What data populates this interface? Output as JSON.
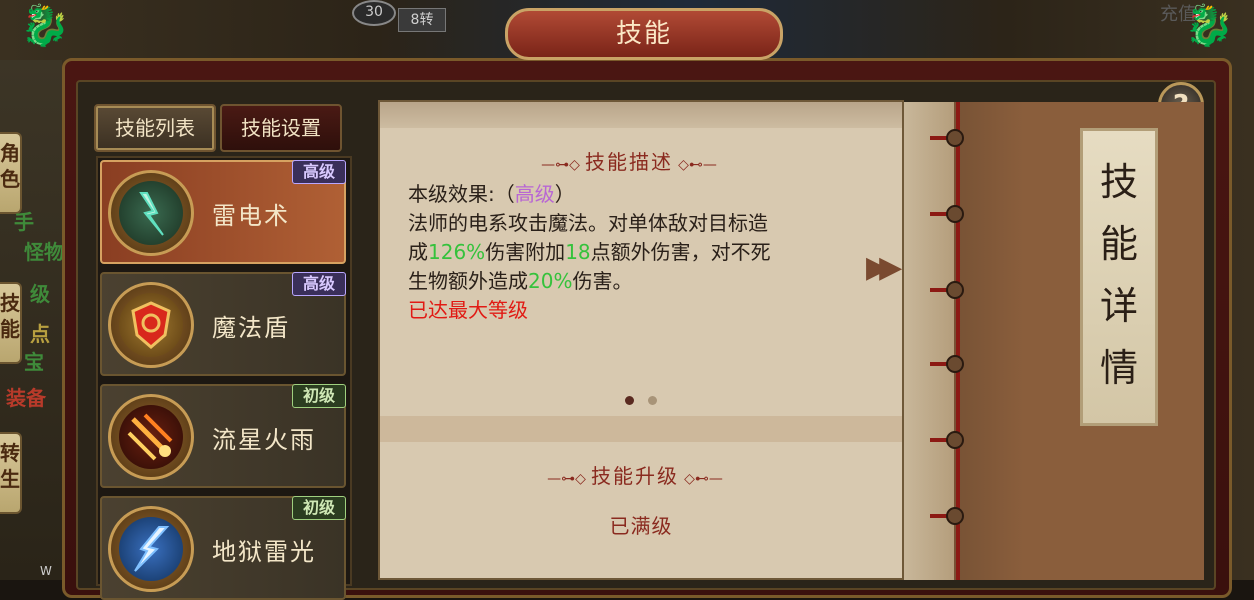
{
  "window_title": "技能",
  "background": {
    "top_counter": "30",
    "top_badge": "8转",
    "left_side_tabs": [
      "角色",
      "技能",
      "转生"
    ],
    "left_ghost_text": [
      "手",
      "怪物(",
      "级",
      "点",
      "宝",
      "装备"
    ],
    "bottom_left": "W",
    "top_right_ghost": "充值"
  },
  "help_button": "?",
  "tabs": [
    {
      "label": "技能列表",
      "active": true
    },
    {
      "label": "技能设置",
      "active": false
    }
  ],
  "skills": [
    {
      "name": "雷电术",
      "grade": "高级",
      "grade_type": "high",
      "selected": true,
      "icon": "lightning-icon"
    },
    {
      "name": "魔法盾",
      "grade": "高级",
      "grade_type": "high",
      "selected": false,
      "icon": "shield-icon"
    },
    {
      "name": "流星火雨",
      "grade": "初级",
      "grade_type": "low",
      "selected": false,
      "icon": "meteor-icon"
    },
    {
      "name": "地狱雷光",
      "grade": "初级",
      "grade_type": "low",
      "selected": false,
      "icon": "hell-lightning-icon"
    }
  ],
  "description": {
    "section_title": "技能描述",
    "level_prefix": "本级效果:（",
    "level_value": "高级",
    "level_suffix": "）",
    "line2": "法师的电系攻击魔法。对单体敌对目标造",
    "line3_a": "成",
    "line3_pct": "126%",
    "line3_b": "伤害附加",
    "line3_num": "18",
    "line3_c": "点额外伤害，对不死",
    "line4_a": "生物额外造成",
    "line4_pct": "20%",
    "line4_b": "伤害。",
    "max_level_note": "已达最大等级"
  },
  "upgrade": {
    "section_title": "技能升级",
    "status": "已满级"
  },
  "book_label": [
    "技",
    "能",
    "详",
    "情"
  ],
  "colors": {
    "highlight_purple": "#b866d4",
    "highlight_green": "#35c23c",
    "highlight_red": "#e11a14",
    "title_red": "#8a2a1f"
  }
}
